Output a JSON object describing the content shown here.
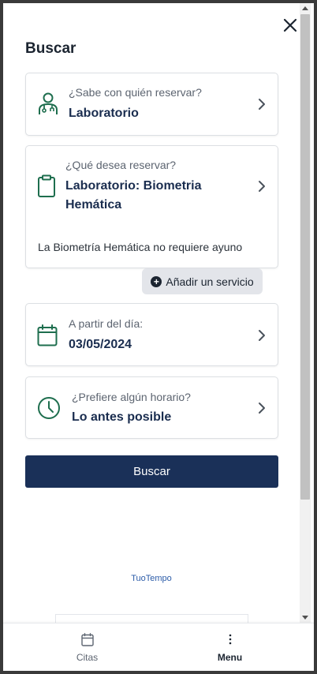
{
  "header": {
    "title": "Buscar"
  },
  "cards": {
    "professional": {
      "label": "¿Sabe con quién reservar?",
      "value": "Laboratorio",
      "icon": "doctor-icon"
    },
    "service": {
      "label": "¿Qué desea reservar?",
      "value_line1": "Laboratorio: Biometria",
      "value_line2": "Hemática",
      "description": "La Biometría Hemática no requiere ayuno",
      "icon": "clipboard-icon"
    },
    "date": {
      "label": "A partir del día:",
      "value": "03/05/2024",
      "icon": "calendar-icon"
    },
    "time": {
      "label": "¿Prefiere algún horario?",
      "value": "Lo antes posible",
      "icon": "clock-icon"
    }
  },
  "actions": {
    "add_service": "Añadir un servicio",
    "search": "Buscar"
  },
  "footer": {
    "brand": "TuoTempo"
  },
  "bottom_nav": {
    "items": [
      {
        "label": "Citas",
        "icon": "calendar-icon"
      },
      {
        "label": "Menu",
        "icon": "more-vertical-icon"
      }
    ]
  },
  "colors": {
    "accent_green": "#1e6e4e",
    "primary_navy": "#1a3058",
    "value_text": "#1a2d4f"
  }
}
